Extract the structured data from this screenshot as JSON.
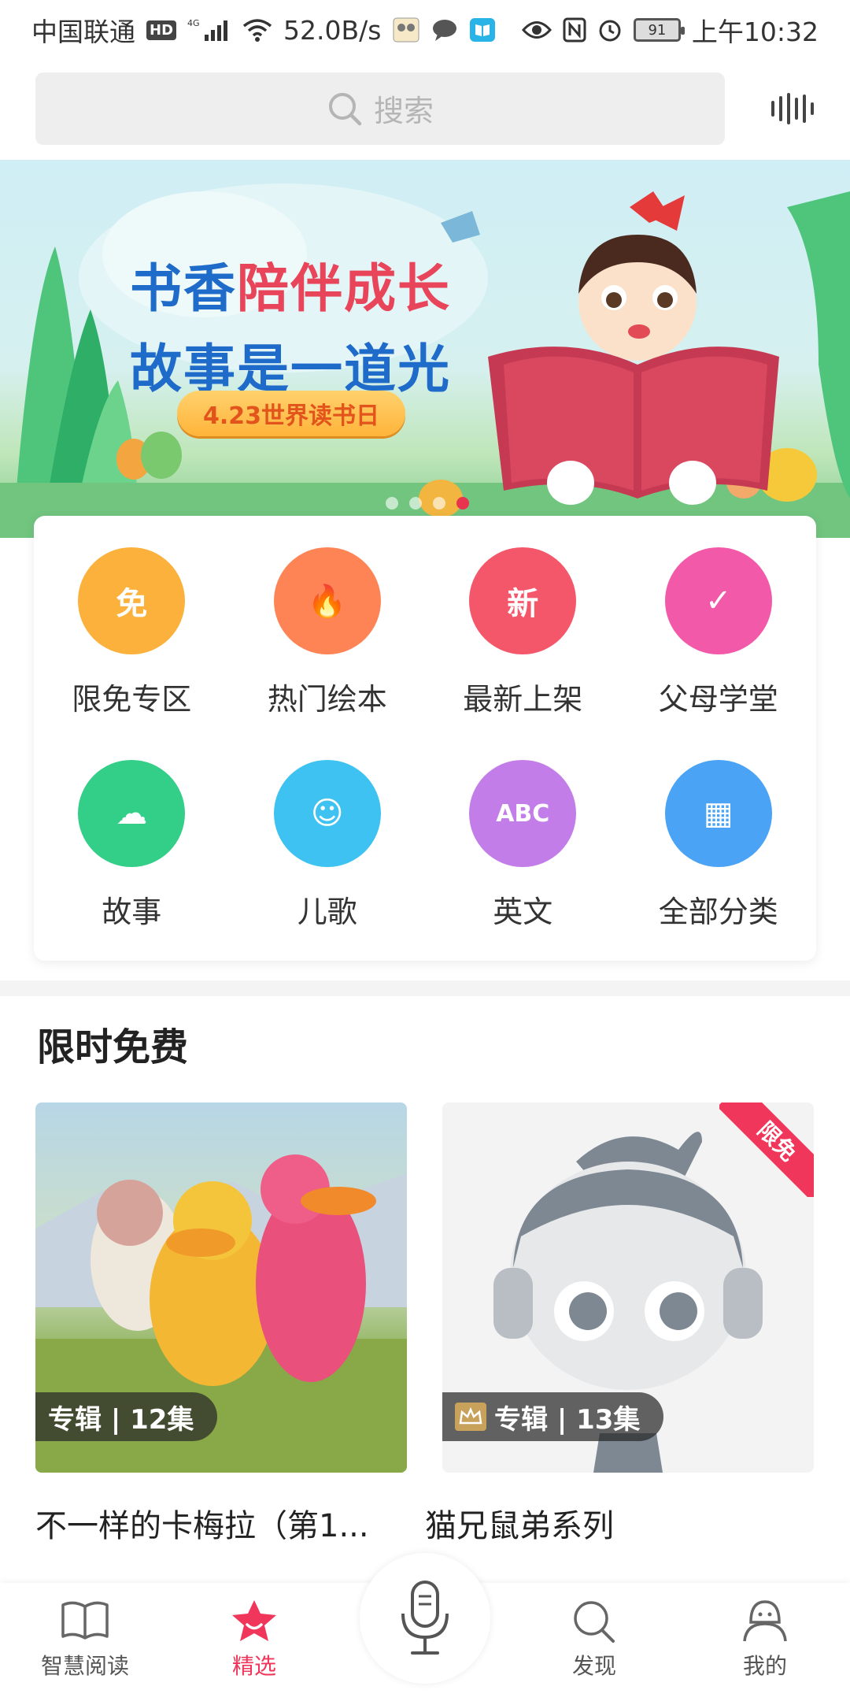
{
  "status_bar": {
    "carrier": "中国联通",
    "hd": "HD",
    "network": "4G",
    "speed": "52.0B/s",
    "battery": "91",
    "time": "上午10:32"
  },
  "search": {
    "placeholder": "搜索"
  },
  "banner": {
    "line1_a": "书香",
    "line1_b": "陪伴成长",
    "line2": "故事是一道光",
    "pill": "4.23世界读书日",
    "slides": 4,
    "active_slide": 3
  },
  "categories": [
    {
      "label": "限免专区",
      "glyph": "免",
      "color": "#fbb13c",
      "icon": "shopping-bag-free-icon"
    },
    {
      "label": "热门绘本",
      "glyph": "🔥",
      "color": "#fe8456",
      "icon": "hot-book-icon"
    },
    {
      "label": "最新上架",
      "glyph": "新",
      "color": "#f4566a",
      "icon": "new-badge-icon"
    },
    {
      "label": "父母学堂",
      "glyph": "✓",
      "color": "#f25aa9",
      "icon": "calendar-check-icon"
    },
    {
      "label": "故事",
      "glyph": "☁",
      "color": "#33cf89",
      "icon": "cloud-face-icon"
    },
    {
      "label": "儿歌",
      "glyph": "☺",
      "color": "#3ec2f1",
      "icon": "face-icon"
    },
    {
      "label": "英文",
      "glyph": "ABC",
      "color": "#c27de8",
      "icon": "abc-blocks-icon"
    },
    {
      "label": "全部分类",
      "glyph": "▦",
      "color": "#4aa3f5",
      "icon": "grid-icon"
    }
  ],
  "section": {
    "title": "限时免费"
  },
  "albums": [
    {
      "badge": "专辑 | 12集",
      "title": "不一样的卡梅拉（第1...",
      "vip": false
    },
    {
      "badge": "专辑 | 13集",
      "title": "猫兄鼠弟系列",
      "vip": true,
      "ribbon": "限免"
    }
  ],
  "tabs": {
    "read": "智慧阅读",
    "pick": "精选",
    "find": "发现",
    "mine": "我的",
    "accent": "#f0365a"
  }
}
